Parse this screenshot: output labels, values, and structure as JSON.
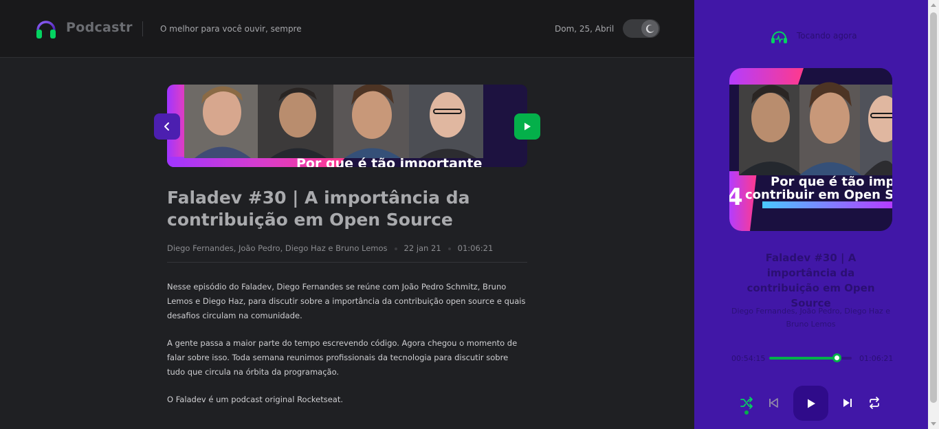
{
  "header": {
    "brand": "Podcastr",
    "tagline": "O melhor para você ouvir, sempre",
    "date": "Dom, 25, Abril",
    "theme_toggle_icon": "moon-icon"
  },
  "episode": {
    "banner_caption": "Por que é tão importante",
    "title": "Faladev #30 | A importância da contribuição em Open Source",
    "members": "Diego Fernandes, João Pedro, Diego Haz e Bruno Lemos",
    "published_at": "22 jan 21",
    "duration": "01:06:21",
    "description": [
      "Nesse episódio do Faladev, Diego Fernandes se reúne com João Pedro Schmitz, Bruno Lemos e Diego Haz, para discutir sobre a importância da contribuição open source e quais desafios circulam na comunidade.",
      "A gente passa a maior parte do tempo escrevendo código. Agora chegou o momento de falar sobre isso. Toda semana reunimos profissionais da tecnologia para discutir sobre tudo que circula na órbita da programação.",
      "O Faladev é um podcast original Rocketseat."
    ]
  },
  "player": {
    "now_playing_label": "Tocando agora",
    "cover_caption_line1": "Por que é tão imp",
    "cover_caption_line2": "contribuir em Open S",
    "cover_number": "4",
    "title": "Faladev #30 | A importância da contribuição em Open Source",
    "members": "Diego Fernandes, João Pedro, Diego Haz e Bruno Lemos",
    "current_time": "00:54:15",
    "total_time": "01:06:21",
    "progress": 0.82,
    "shuffle_active": true
  },
  "colors": {
    "accent_purple": "#4117a7",
    "accent_green": "#04b04a",
    "background": "#1f2023"
  }
}
